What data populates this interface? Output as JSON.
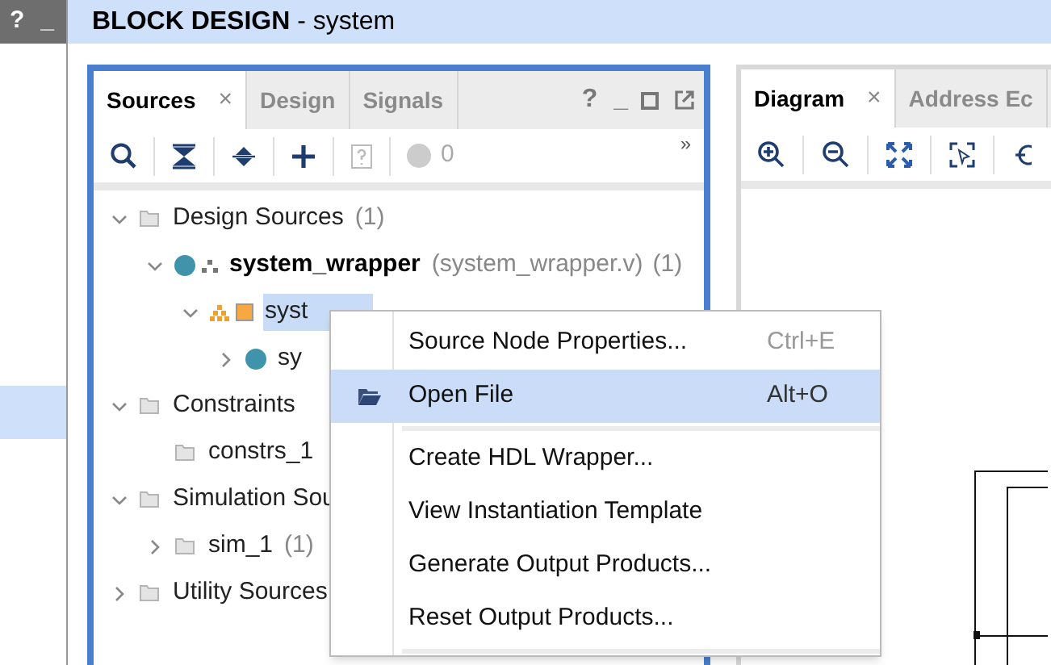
{
  "left_strip": {
    "buttons": [
      "?",
      "_"
    ]
  },
  "header": {
    "title": "BLOCK DESIGN",
    "subtitle": " - system"
  },
  "sources_panel": {
    "tabs": [
      {
        "label": "Sources",
        "selected": true,
        "close": "×"
      },
      {
        "label": "Design",
        "selected": false
      },
      {
        "label": "Signals",
        "selected": false
      }
    ],
    "window_buttons": [
      "?",
      "_"
    ],
    "toolbar": {
      "count": "0",
      "more": "»"
    },
    "tree": [
      {
        "label": "Design Sources",
        "count": "(1)",
        "expanded": true,
        "kind": "folder",
        "selected": false,
        "children": [
          {
            "label": "system_wrapper",
            "suffix": "(system_wrapper.v)",
            "count": "(1)",
            "expanded": true,
            "kind": "wrapper",
            "selected": false,
            "children": [
              {
                "label": "syst",
                "expanded": true,
                "kind": "bd",
                "selected": true,
                "children": [
                  {
                    "label": "sy",
                    "expanded": false,
                    "kind": "module",
                    "selected": false
                  }
                ]
              }
            ]
          }
        ]
      },
      {
        "label": "Constraints",
        "expanded": true,
        "kind": "folder",
        "selected": false,
        "children": [
          {
            "label": "constrs_1",
            "kind": "folder",
            "selected": false
          }
        ]
      },
      {
        "label": "Simulation Sou",
        "expanded": true,
        "kind": "folder",
        "selected": false,
        "children": [
          {
            "label": "sim_1",
            "count": "(1)",
            "expanded": false,
            "kind": "folder",
            "selected": false
          }
        ]
      },
      {
        "label": "Utility Sources",
        "expanded": false,
        "kind": "folder",
        "selected": false
      }
    ]
  },
  "diagram_panel": {
    "tabs": [
      {
        "label": "Diagram",
        "selected": true,
        "close": "×"
      },
      {
        "label": "Address Ec",
        "selected": false
      }
    ]
  },
  "context_menu": {
    "groups": [
      [
        {
          "label": "Source Node Properties...",
          "shortcut": "Ctrl+E",
          "selected": false
        },
        {
          "label": "Open File",
          "shortcut": "Alt+O",
          "selected": true,
          "kind": "open"
        }
      ],
      [
        {
          "label": "Create HDL Wrapper...",
          "selected": false
        },
        {
          "label": "View Instantiation Template",
          "selected": false
        },
        {
          "label": "Generate Output Products...",
          "selected": false
        },
        {
          "label": "Reset Output Products...",
          "selected": false
        }
      ]
    ]
  }
}
